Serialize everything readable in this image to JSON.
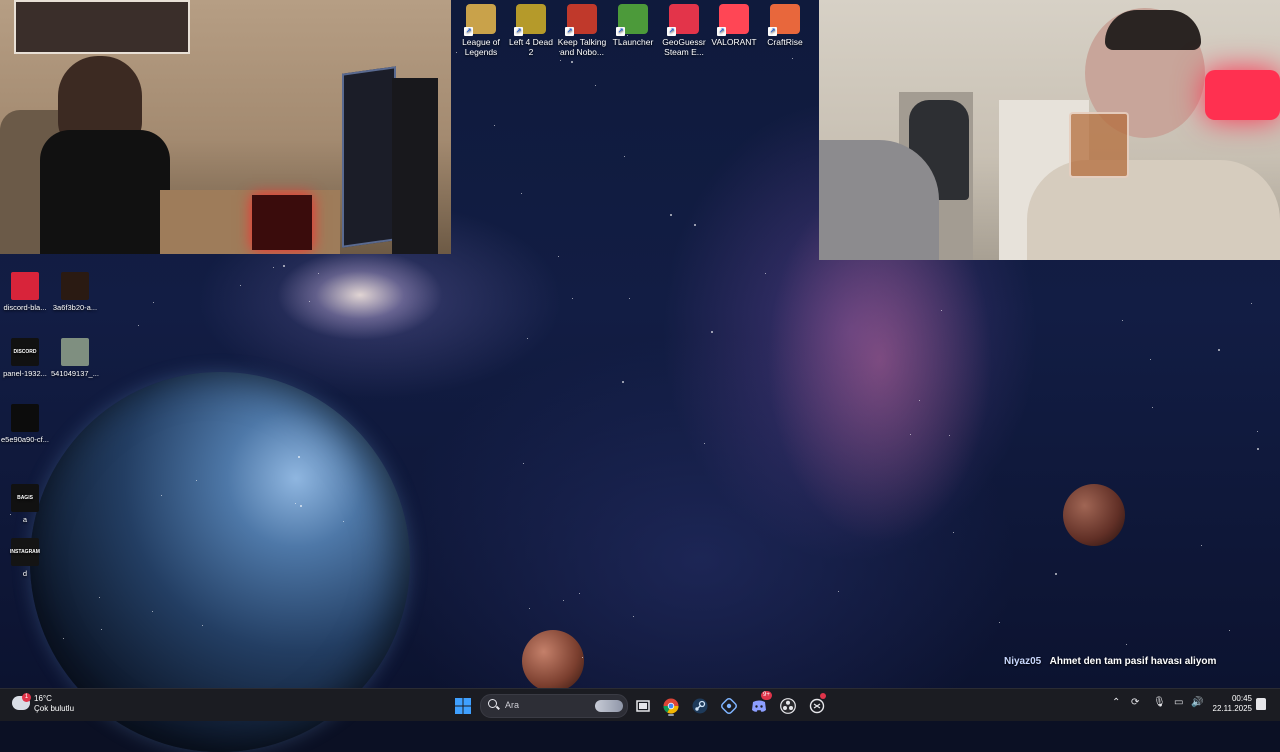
{
  "desktop": {
    "top_icons": [
      {
        "label": "League of Legends",
        "icon": "league-of-legends-icon",
        "color": "#c9a24a"
      },
      {
        "label": "Left 4 Dead 2",
        "icon": "left4dead2-icon",
        "color": "#b59a2a"
      },
      {
        "label": "Keep Talking and Nobo...",
        "icon": "keep-talking-icon",
        "color": "#c0392b"
      },
      {
        "label": "TLauncher",
        "icon": "tlauncher-icon",
        "color": "#4c9a3a"
      },
      {
        "label": "GeoGuessr Steam E...",
        "icon": "geoguessr-icon",
        "color": "#e3344a"
      },
      {
        "label": "VALORANT",
        "icon": "valorant-icon",
        "color": "#ff4655"
      },
      {
        "label": "CraftRise",
        "icon": "craftrise-icon",
        "color": "#e8673c"
      }
    ],
    "left_icons": [
      {
        "label": "discord-bla...",
        "icon": "discord-image-icon",
        "color": "#d8243a",
        "inner": ""
      },
      {
        "label": "3a6f3b20-a...",
        "icon": "image-file-icon",
        "color": "#2a1a12",
        "inner": ""
      },
      {
        "label": "panel-1932...",
        "icon": "discord-panel-image-icon",
        "color": "#111111",
        "inner": "DISCORD"
      },
      {
        "label": "541049137_...",
        "icon": "photo-file-icon",
        "color": "#7f8f80",
        "inner": ""
      },
      {
        "label": "e5e90a90-cf...",
        "icon": "logo-image-icon",
        "color": "#0c0c0c",
        "inner": ""
      },
      {
        "label": "a",
        "icon": "bagis-image-icon",
        "color": "#111111",
        "inner": "BAGIS"
      },
      {
        "label": "d",
        "icon": "instagram-image-icon",
        "color": "#141414",
        "inner": "INSTAGRAM"
      }
    ]
  },
  "chat": {
    "user": "Niyaz05",
    "message": "Ahmet den tam pasif havası aliyom"
  },
  "taskbar": {
    "weather": {
      "temp": "16°C",
      "condition": "Çok bulutlu",
      "badge": "1"
    },
    "search_placeholder": "Ara",
    "apps": [
      {
        "icon": "windows-start-icon",
        "color": "#3fa0ff"
      },
      {
        "icon": "task-view-icon",
        "color": "#e6e6ea"
      },
      {
        "icon": "chrome-icon",
        "color": "#f2b600"
      },
      {
        "icon": "steam-icon",
        "color": "#8fb8e0"
      },
      {
        "icon": "network-app-icon",
        "color": "#7fb4ff"
      },
      {
        "icon": "discord-icon",
        "color": "#8c9eff"
      },
      {
        "icon": "obs-icon",
        "color": "#e6e6ea"
      },
      {
        "icon": "chatgpt-icon",
        "color": "#e6e6ea"
      }
    ],
    "discord_badge": "9+",
    "clock": {
      "time": "00:45",
      "date": "22.11.2025"
    }
  }
}
